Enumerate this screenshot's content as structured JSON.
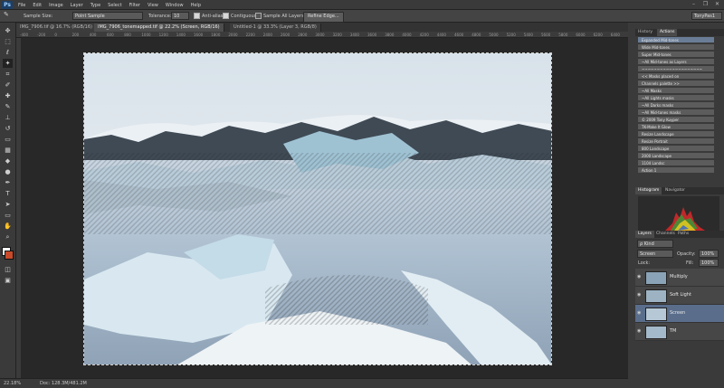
{
  "app": {
    "logo": "Ps"
  },
  "menu": [
    "File",
    "Edit",
    "Image",
    "Layer",
    "Type",
    "Select",
    "Filter",
    "View",
    "Window",
    "Help"
  ],
  "window_controls": {
    "minimize": "–",
    "restore": "❐",
    "close": "✕"
  },
  "options": {
    "sample_size_label": "Sample Size:",
    "sample_size_value": "Point Sample",
    "tolerance_label": "Tolerance:",
    "tolerance_value": "10",
    "anti_alias": "Anti-alias",
    "contiguous": "Contiguous",
    "sample_all_layers": "Sample All Layers",
    "refine_edge": "Refine Edge...",
    "workspace": "TonyPas1"
  },
  "tabs": [
    "IMG_7906.tif @ 16.7% (RGB/16)",
    "IMG_7906_tonemapped.tif @ 22.2% (Screen, RGB/16)",
    "Untitled-1 @ 33.3% (Layer 3, RGB/8)"
  ],
  "ruler_ticks": [
    "-400",
    "-200",
    "0",
    "200",
    "400",
    "600",
    "800",
    "1000",
    "1200",
    "1400",
    "1600",
    "1800",
    "2000",
    "2200",
    "2400",
    "2600",
    "2800",
    "3000",
    "3200",
    "3400",
    "3600",
    "3800",
    "4000",
    "4200",
    "4400",
    "4600",
    "4800",
    "5000",
    "5200",
    "5400",
    "5600",
    "5800",
    "6000",
    "6200",
    "6400"
  ],
  "status": {
    "zoom": "22.18%",
    "doc": "Doc: 128.3M/481.2M"
  },
  "panels": {
    "top_tabs": [
      "History",
      "Actions"
    ],
    "actions": [
      "Expanded Mid-tones",
      "Wide Mid-tones",
      "Super Mid-tones",
      "~All Mid-tones as Layers",
      "~~~~~~~~~~~~~~~~~~~~",
      "<< Masks placed on",
      "Channels palette >>",
      "~All Masks",
      "~All Lights masks",
      "~All Darks masks",
      "~All Mid-tones masks",
      "© 2009 Tony Kuyper",
      "TK-Make It Glow",
      "Resize Landscape",
      "Resize Portrait",
      "800 Landscape",
      "2000 Landscape",
      "1104 Landsc",
      "Action 1"
    ],
    "hist_tabs": [
      "Histogram",
      "Navigator"
    ],
    "layers_tabs": [
      "Layers",
      "Channels",
      "Paths"
    ],
    "layers_kind": "ρ Kind",
    "blend_mode": "Screen",
    "opacity_label": "Opacity:",
    "opacity_value": "100%",
    "lock_label": "Lock:",
    "fill_label": "Fill:",
    "fill_value": "100%",
    "layers": [
      "Multiply",
      "Soft Light",
      "Screen",
      "TM"
    ]
  },
  "colors": {
    "accent_selected": "#5a6e8c",
    "foreground": "#c84a2a",
    "background": "#ffffff"
  }
}
